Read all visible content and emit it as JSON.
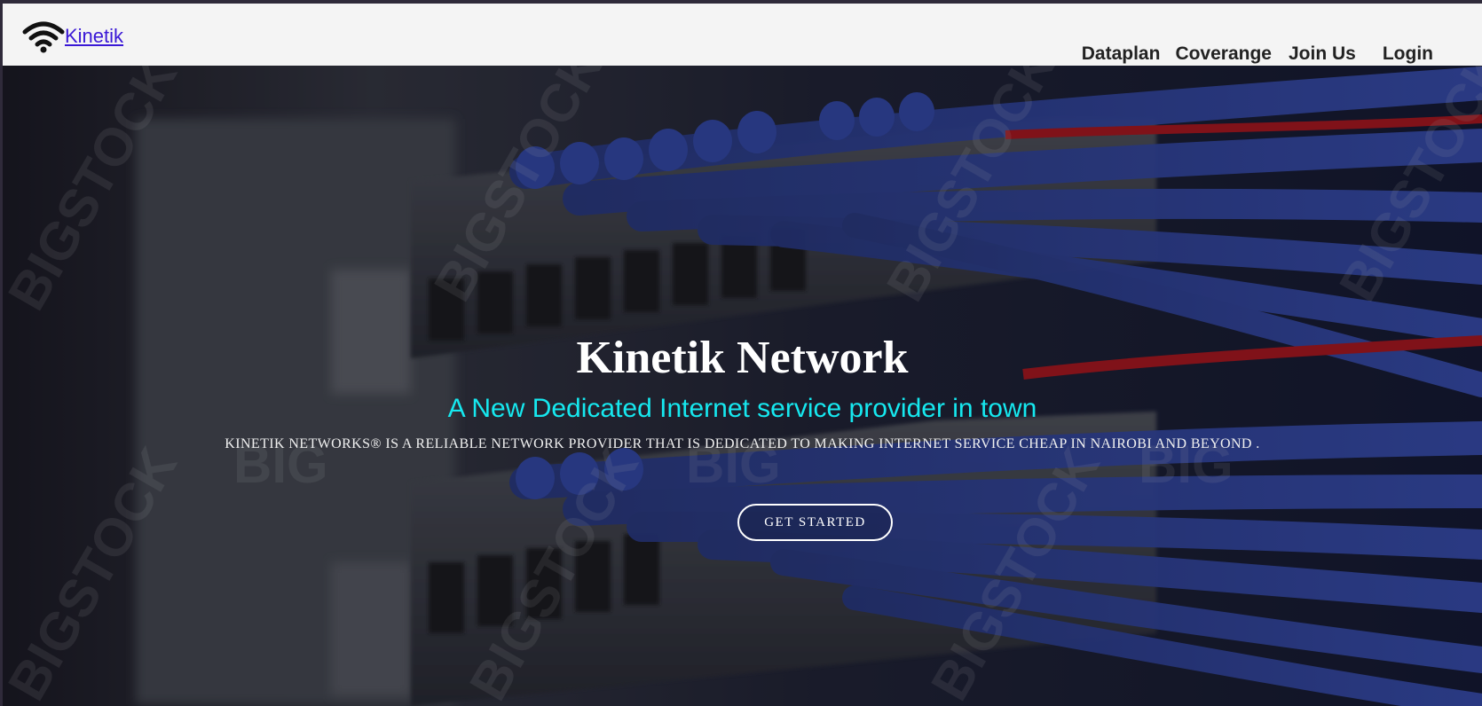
{
  "navbar": {
    "brand_label": "Kinetik",
    "brand_icon": "wifi-icon",
    "links": {
      "dataplan": "Dataplan",
      "coverage": "Coverange",
      "join_us": "Join Us",
      "login": "Login"
    }
  },
  "hero": {
    "title": "Kinetik Network",
    "subtitle": "A New Dedicated Internet service provider in town",
    "description": "KINETIK NETWORKS® IS A RELIABLE NETWORK PROVIDER THAT IS DEDICATED TO MAKING INTERNET SERVICE CHEAP IN NAIROBI AND BEYOND .",
    "cta_label": "GET STARTED",
    "background": "network-switch-cables-photo"
  },
  "colors": {
    "brand_link": "#3a18d6",
    "subtitle": "#16e8ef",
    "navbar_bg": "#f4f4f4"
  }
}
